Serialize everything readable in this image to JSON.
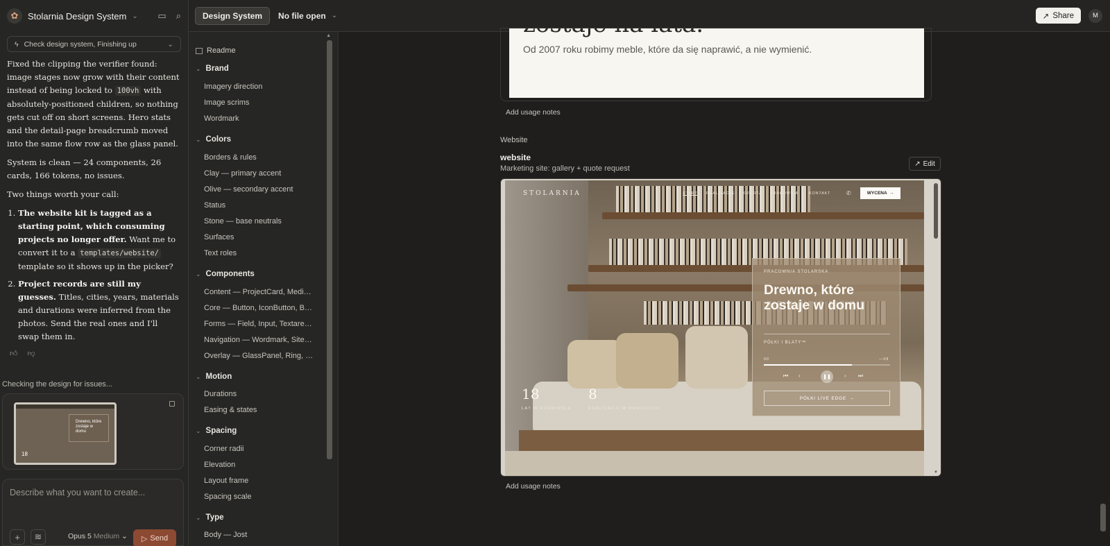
{
  "app": {
    "project_name": "Stolarnia Design System"
  },
  "chat": {
    "task_pill": "Check design system, Finishing up",
    "p1_a": "Fixed the clipping the verifier found: image stages now grow with their content instead of being locked to ",
    "p1_code": "100vh",
    "p1_b": " with absolutely-positioned children, so nothing gets cut off on short screens. Hero stats and the detail-page breadcrumb moved into the same flow row as the glass panel.",
    "p2": "System is clean — 24 components, 26 cards, 166 tokens, no issues.",
    "p3": "Two things worth your call:",
    "li1_bold": "The website kit is tagged as a starting point, which consuming projects no longer offer.",
    "li1_a": " Want me to convert it to a ",
    "li1_code": "templates/website/",
    "li1_b": " template so it shows up in the picker?",
    "li2_bold": "Project records are still my guesses.",
    "li2_a": " Titles, cities, years, materials and durations were inferred from the photos. Send the real ones and I'll swap them in.",
    "status": "Checking the design for issues...",
    "composer_placeholder": "Describe what you want to create...",
    "model_name": "Opus 5",
    "model_effort": "Medium",
    "send_label": "Send"
  },
  "topbar": {
    "tab": "Design System",
    "file": "No file open",
    "share": "Share",
    "avatar": "M"
  },
  "nav": {
    "readme": "Readme",
    "sections": [
      {
        "title": "Brand",
        "items": [
          "Imagery direction",
          "Image scrims",
          "Wordmark"
        ]
      },
      {
        "title": "Colors",
        "items": [
          "Borders & rules",
          "Clay — primary accent",
          "Olive — secondary accent",
          "Status",
          "Stone — base neutrals",
          "Surfaces",
          "Text roles"
        ]
      },
      {
        "title": "Components",
        "items": [
          "Content — ProjectCard, MediaFrame",
          "Core — Button, IconButton, Badge",
          "Forms — Field, Input, Textarea, Select",
          "Navigation — Wordmark, SiteHeader",
          "Overlay — GlassPanel, Ring, Scrim"
        ]
      },
      {
        "title": "Motion",
        "items": [
          "Durations",
          "Easing & states"
        ]
      },
      {
        "title": "Spacing",
        "items": [
          "Corner radii",
          "Elevation",
          "Layout frame",
          "Spacing scale"
        ]
      },
      {
        "title": "Type",
        "items": [
          "Body — Jost"
        ]
      }
    ]
  },
  "main": {
    "card1_heading": "zostaje na lata.",
    "card1_sub": "Od 2007 roku robimy meble, które da się naprawić, a nie wymienić.",
    "usage_notes": "Add usage notes",
    "section_label": "Website",
    "card_title": "website",
    "card_desc": "Marketing site: gallery + quote request",
    "edit_label": "Edit"
  },
  "site": {
    "logo": "STOLARNIA",
    "nav": [
      "START",
      "REALIZACJE",
      "OFERTA",
      "PRACOWNIA",
      "KONTAKT"
    ],
    "cta": "WYCENA",
    "kicker": "PRACOWNIA STOLARSKA",
    "headline": "Drewno, które zostaje w domu",
    "product": "PÓŁKI I BLATY™",
    "time_start": "0:0",
    "time_end": "— 0:8",
    "progress": 0.7,
    "button": "PÓŁKI LIVE EDGE",
    "stat1_num": "18",
    "stat1_label": "LAT W RZEMIOŚLE",
    "stat2_num": "8",
    "stat2_label": "REALIZACJI W PORTFOLIO"
  },
  "thumb": {
    "headline": "Drewno, które zostaje w domu",
    "stat": "18"
  }
}
